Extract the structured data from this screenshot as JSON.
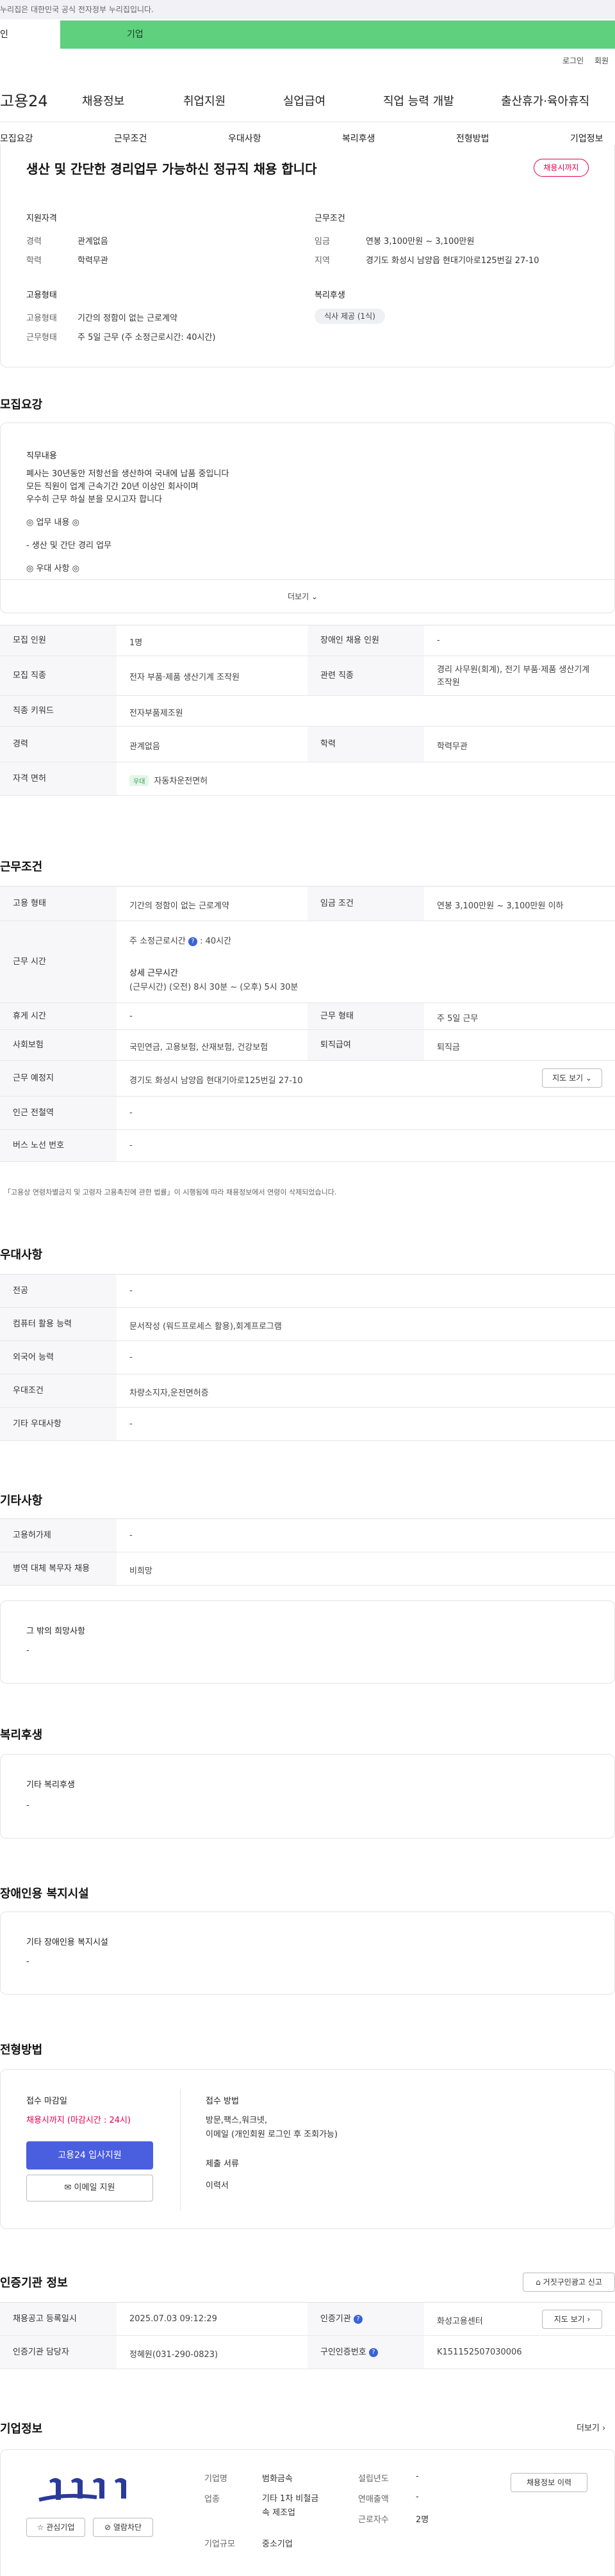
{
  "topbar": {
    "notice": "누리집은 대한민국 공식 전자정부 누리집입니다."
  },
  "tabs": {
    "person": "인",
    "company": "기업"
  },
  "util": {
    "login": "로그인",
    "join": "회원"
  },
  "gnb": {
    "logo": "고용24",
    "menu": [
      "채용정보",
      "취업지원",
      "실업급여",
      "직업 능력 개발",
      "출산휴가·육아휴직"
    ]
  },
  "subnav": [
    "모집요강",
    "근무조건",
    "우대사항",
    "복리후생",
    "전형방법",
    "기업정보"
  ],
  "summary": {
    "title": "생산 및 간단한 경리업무 가능하신 정규직 채용 합니다",
    "badge": "채용시까지",
    "qual_h": "지원자격",
    "cond_h": "근무조건",
    "career_l": "경력",
    "career_v": "관계없음",
    "edu_l": "학력",
    "edu_v": "학력무관",
    "pay_l": "임금",
    "pay_v": "연봉 3,100만원 ~ 3,100만원",
    "loc_l": "지역",
    "loc_v": "경기도 화성시 남양읍 현대기아로125번길 27-10",
    "emp_h": "고용형태",
    "welfare_h": "복리후생",
    "etype_l": "고용형태",
    "etype_v": "기간의 정함이 없는 근로계약",
    "wtype_l": "근무형태",
    "wtype_v": "주 5일 근무 (주 소정근로시간: 40시간)",
    "welfare_pill": "식사 제공 (1식)"
  },
  "recruit": {
    "title": "모집요강",
    "job_h": "직무내용",
    "job_lines": [
      "폐사는 30년동안 저항선을 생산하여 국내에 납품 중입니다",
      "모든 직원이 업계 근속기간 20년 이상인 회사이며",
      "우수히 근무 하실 분을 모시고자 합니다",
      "◎ 업무 내용 ◎",
      "- 생산 및 간단 경리 업무",
      "◎ 우대 사항 ◎"
    ],
    "more": "더보기"
  },
  "recruit_table": {
    "count_l": "모집 인원",
    "count_v": "1명",
    "disab_l": "장애인 채용 인원",
    "disab_v": "-",
    "job_l": "모집 직종",
    "job_v": "전자 부품·제품 생산기계 조작원",
    "rel_l": "관련 직종",
    "rel_v1": "경리 사무원(회계), 전기 부품·제품 생산기계",
    "rel_v2": "조작원",
    "kw_l": "직종 키워드",
    "kw_v": "전자부품제조원",
    "career_l": "경력",
    "career_v": "관계없음",
    "edu_l": "학력",
    "edu_v": "학력무관",
    "lic_l": "자격 면허",
    "lic_badge": "우대",
    "lic_v": "자동차운전면허"
  },
  "work": {
    "title": "근무조건",
    "etype_l": "고용 형태",
    "etype_v": "기간의 정함이 없는 근로계약",
    "pay_l": "임금 조건",
    "pay_v": "연봉 3,100만원 ~ 3,100만원 이하",
    "time_l": "근무 시간",
    "time_h": "주 소정근로시간",
    "time_hours": "40시간",
    "time_detail_h": "상세 근무시간",
    "time_detail_v": "(근무시간) (오전) 8시 30분 ~ (오후) 5시 30분",
    "rest_l": "휴게 시간",
    "rest_v": "-",
    "form_l": "근무 형태",
    "form_v": "주 5일 근무",
    "ins_l": "사회보험",
    "ins_v": "국민연금, 고용보험, 산재보험, 건강보험",
    "ret_l": "퇴직급여",
    "ret_v": "퇴직금",
    "place_l": "근무 예정지",
    "place_v": "경기도 화성시 남양읍 현대기아로125번길 27-10",
    "map_btn": "지도 보기",
    "sub_l": "인근 전철역",
    "sub_v": "-",
    "bus_l": "버스 노선 번호",
    "bus_v": "-",
    "note": "「고용상 연령차별금지 및 고령자 고용촉진에 관한 법률」이 시행됨에 따라 채용정보에서 연령이 삭제되었습니다."
  },
  "pref": {
    "title": "우대사항",
    "major_l": "전공",
    "major_v": "-",
    "pc_l": "컴퓨터 활용 능력",
    "pc_v": "문서작성 (워드프로세스 활용),회계프로그램",
    "lang_l": "외국어 능력",
    "lang_v": "-",
    "cond_l": "우대조건",
    "cond_v": "차량소지자,운전면허증",
    "etc_l": "기타 우대사항",
    "etc_v": "-"
  },
  "etc": {
    "title": "기타사항",
    "ins_l": "고용허가제",
    "ins_v": "-",
    "mil_l": "병역 대체 복무자 채용",
    "mil_v": "비희망",
    "wish_h": "그 밖의 희망사항",
    "wish_v": "-"
  },
  "welfare": {
    "title": "복리후생",
    "h": "기타 복리후생",
    "v": "-"
  },
  "disab": {
    "title": "장애인용 복지시설",
    "h": "기타 장애인용 복지시설",
    "v": "-"
  },
  "select": {
    "title": "전형방법",
    "deadline_h": "접수 마감일",
    "deadline_v": "채용시까지 (마감시간 : 24시)",
    "apply_btn": "고용24 입사지원",
    "email_btn": "이메일 지원",
    "method_h": "접수 방법",
    "method_v1": "방문,팩스,워크넷,",
    "method_v2": "이메일 (개인회원 로그인 후 조회가능)",
    "docs_h": "제출 서류",
    "docs_v": "이력서"
  },
  "agency": {
    "title": "인증기관 정보",
    "report_btn": "거짓구인광고 신고",
    "reg_l": "채용공고 등록일시",
    "reg_v": "2025.07.03 09:12:29",
    "org_l": "인증기관",
    "org_v": "화성고용센터",
    "map_btn": "지도 보기",
    "mgr_l": "인증기관 담당자",
    "mgr_v": "정혜원(031-290-0823)",
    "no_l": "구인인증번호",
    "no_v": "K151152507030006"
  },
  "company": {
    "title": "기업정보",
    "more": "더보기",
    "name_l": "기업명",
    "name_v": "범화금속",
    "year_l": "설립년도",
    "year_v": "-",
    "ind_l": "업종",
    "ind_v1": "기타 1차 비철금",
    "ind_v2": "속 제조업",
    "sales_l": "연매출액",
    "sales_v": "-",
    "staff_l": "근로자수",
    "staff_v": "2명",
    "size_l": "기업규모",
    "size_v": "중소기업",
    "info_btn": "채용정보 이력",
    "fav_btn": "관심기업",
    "block_btn": "열람차단"
  },
  "colors": {
    "accent_green": "#5ed07e",
    "accent_blue": "#4a5ee0",
    "accent_red": "#e5004f"
  }
}
